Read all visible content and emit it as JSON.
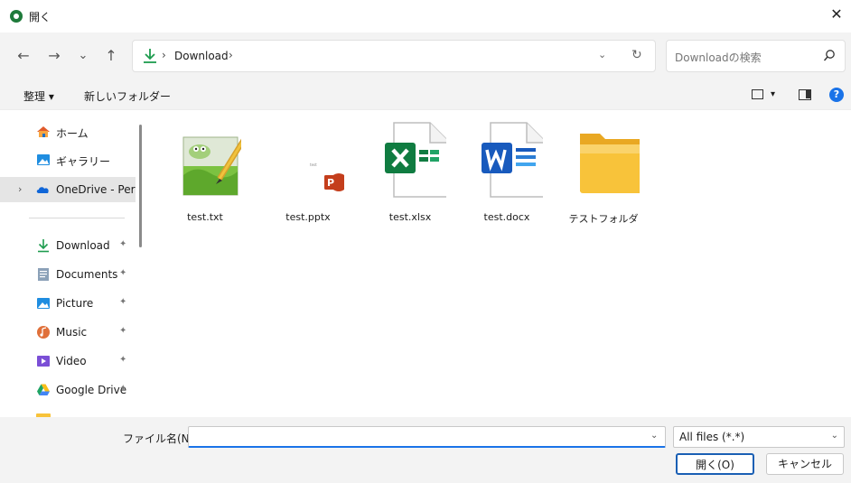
{
  "window": {
    "title": "開く",
    "close_glyph": "✕"
  },
  "navigation": {
    "back_glyph": "←",
    "forward_glyph": "→",
    "history_glyph": "⌄",
    "up_glyph": "↑",
    "separator_glyph": "›",
    "path": "Download",
    "dropdown_glyph": "⌄",
    "refresh_glyph": "↻"
  },
  "search": {
    "placeholder": "Downloadの検索"
  },
  "commands": {
    "organize": "整理 ▾",
    "new_folder": "新しいフォルダー",
    "view_dropdown": "▾",
    "help": "?"
  },
  "sidebar": {
    "items": [
      {
        "label": "ホーム",
        "icon": "home-icon"
      },
      {
        "label": "ギャラリー",
        "icon": "gallery-icon"
      },
      {
        "label": "OneDrive - Personal",
        "icon": "onedrive-icon",
        "expandable": true,
        "selected": true
      },
      {
        "label": "Download",
        "icon": "download-icon",
        "pinned": true
      },
      {
        "label": "Documents",
        "icon": "documents-icon",
        "pinned": true
      },
      {
        "label": "Picture",
        "icon": "picture-icon",
        "pinned": true
      },
      {
        "label": "Music",
        "icon": "music-icon",
        "pinned": true
      },
      {
        "label": "Video",
        "icon": "video-icon",
        "pinned": true
      },
      {
        "label": "Google Drive",
        "icon": "google-drive-icon",
        "pinned": true
      }
    ],
    "pin_glyph": "✦",
    "chevron_glyph": "›"
  },
  "files": [
    {
      "name": "test.txt",
      "icon": "notepad-icon"
    },
    {
      "name": "test.pptx",
      "icon": "powerpoint-icon",
      "thumb_text": "test"
    },
    {
      "name": "test.xlsx",
      "icon": "excel-icon"
    },
    {
      "name": "test.docx",
      "icon": "word-icon"
    },
    {
      "name": "テストフォルダ",
      "icon": "folder-icon"
    }
  ],
  "bottom": {
    "filename_label": "ファイル名(N):",
    "filename_value": "",
    "filename_dropdown": "⌄",
    "filetype": "All files (*.*)",
    "filetype_dropdown": "⌄",
    "open_button": "開く(O)",
    "cancel_button": "キャンセル"
  },
  "colors": {
    "accent": "#1a73e8",
    "excel": "#107c41",
    "word": "#185abd",
    "powerpoint": "#c43e1c",
    "folder": "#f8c33a"
  }
}
